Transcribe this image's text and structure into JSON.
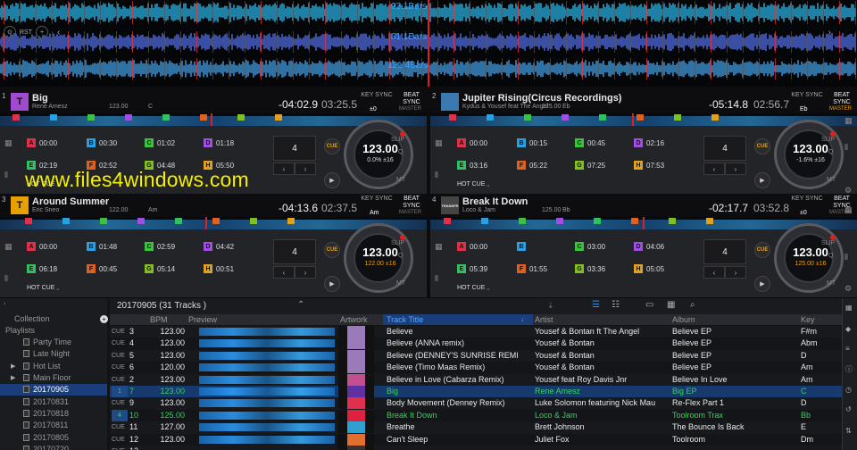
{
  "waveform": {
    "bar_labels": [
      "93.1Bars",
      "81.1Bars",
      "121.4Bars"
    ],
    "left_ctrl": [
      "RST"
    ]
  },
  "decks": [
    {
      "num": "1",
      "title": "Big",
      "artist": "Rene Amesz",
      "bpm": "123.00",
      "key": "C",
      "remain": "-04:02.9",
      "elapsed": "03:25.5",
      "key_label": "KEY SYNC",
      "beat_label": "BEAT SYNC",
      "master": "MASTER",
      "key_val": "±0",
      "art_color": "#a04ad0",
      "art_glyph": "T",
      "beat": "4",
      "jog_bpm": "123.00",
      "jog_pitch": "0.0%  ±16",
      "slip": "SLIP",
      "q": "Q",
      "mt": "MT",
      "mode": "HOT CUE",
      "pads": [
        [
          "A",
          "00:00"
        ],
        [
          "B",
          "00:30"
        ],
        [
          "C",
          "01:02"
        ],
        [
          "D",
          "01:18"
        ],
        [
          "E",
          "02:19"
        ],
        [
          "F",
          "02:52"
        ],
        [
          "G",
          "04:48"
        ],
        [
          "H",
          "05:50"
        ]
      ]
    },
    {
      "num": "2",
      "title": "Jupiter Rising(Circus Recordings)",
      "artist": "Kydus & Yousef feat The Angel",
      "bpm": "125.00",
      "key": "Eb",
      "remain": "-05:14.8",
      "elapsed": "02:56.7",
      "key_label": "KEY SYNC",
      "beat_label": "BEAT SYNC",
      "master": "MASTER",
      "key_val": "Eb",
      "art_color": "#3a7ab0",
      "art_glyph": "",
      "beat": "4",
      "jog_bpm": "123.00",
      "jog_pitch": "-1.6%  ±16",
      "slip": "SLIP",
      "q": "Q",
      "mt": "MT",
      "mode": "HOT CUE",
      "pads": [
        [
          "A",
          "00:00"
        ],
        [
          "B",
          "00:15"
        ],
        [
          "C",
          "00:45"
        ],
        [
          "D",
          "02:16"
        ],
        [
          "E",
          "03:16"
        ],
        [
          "F",
          "05:22"
        ],
        [
          "G",
          "07:25"
        ],
        [
          "H",
          "07:53"
        ]
      ]
    },
    {
      "num": "3",
      "title": "Around Summer",
      "artist": "Eric Sneo",
      "bpm": "122.00",
      "key": "Am",
      "remain": "-04:13.6",
      "elapsed": "02:37.5",
      "key_label": "KEY SYNC",
      "beat_label": "BEAT SYNC",
      "master": "MASTER",
      "key_val": "Am",
      "art_color": "#e8a000",
      "art_glyph": "T",
      "beat": "4",
      "jog_bpm": "123.00",
      "jog_pitch": "122.00  ±16",
      "slip": "SLIP",
      "q": "Q",
      "mt": "MT",
      "mode": "HOT CUE",
      "pads": [
        [
          "A",
          "00:00"
        ],
        [
          "B",
          "01:48"
        ],
        [
          "C",
          "02:59"
        ],
        [
          "D",
          "04:42"
        ],
        [
          "E",
          "06:18"
        ],
        [
          "F",
          "00:45"
        ],
        [
          "G",
          "05:14"
        ],
        [
          "H",
          "00:51"
        ]
      ]
    },
    {
      "num": "4",
      "title": "Break It Down",
      "artist": "Loco & Jam",
      "bpm": "125.00",
      "key": "Bb",
      "remain": "-02:17.7",
      "elapsed": "03:52.8",
      "key_label": "KEY SYNC",
      "beat_label": "BEAT SYNC",
      "master": "MASTER",
      "key_val": "±0",
      "art_color": "#444",
      "art_glyph": "TRANSFR",
      "beat": "4",
      "jog_bpm": "123.00",
      "jog_pitch": "125.00  ±16",
      "slip": "SLIP",
      "q": "Q",
      "mt": "MT",
      "mode": "HOT CUE",
      "pads": [
        [
          "A",
          "00:00"
        ],
        [
          "B",
          ""
        ],
        [
          "C",
          "03:00"
        ],
        [
          "D",
          "04:06"
        ],
        [
          "E",
          "05:39"
        ],
        [
          "F",
          "01:55"
        ],
        [
          "G",
          "03:36"
        ],
        [
          "H",
          "05:05"
        ]
      ]
    }
  ],
  "pad_colors": {
    "A": "#e0304a",
    "B": "#2aa0e0",
    "C": "#40c040",
    "D": "#a050e0",
    "E": "#30c060",
    "F": "#e06020",
    "G": "#80c020",
    "H": "#e0a020"
  },
  "watermark": "www.files4windows.com",
  "browser": {
    "playlist_title": "20170905 (31 Tracks )",
    "tree": [
      {
        "label": "Collection",
        "indent": 16,
        "sel": false,
        "icon": false
      },
      {
        "label": "Playlists",
        "indent": 6,
        "sel": false,
        "icon": false,
        "arrow": "▼"
      },
      {
        "label": "Party Time",
        "indent": 26,
        "sel": false,
        "icon": true
      },
      {
        "label": "Late Night",
        "indent": 26,
        "sel": false,
        "icon": true
      },
      {
        "label": "Hot List",
        "indent": 26,
        "sel": false,
        "icon": true,
        "arrow": "▶"
      },
      {
        "label": "Main Floor",
        "indent": 26,
        "sel": false,
        "icon": true,
        "arrow": "▶"
      },
      {
        "label": "20170905",
        "indent": 26,
        "sel": true,
        "icon": true
      },
      {
        "label": "20170831",
        "indent": 26,
        "sel": false,
        "icon": true
      },
      {
        "label": "20170818",
        "indent": 26,
        "sel": false,
        "icon": true
      },
      {
        "label": "20170811",
        "indent": 26,
        "sel": false,
        "icon": true
      },
      {
        "label": "20170805",
        "indent": 26,
        "sel": false,
        "icon": true
      },
      {
        "label": "20170720",
        "indent": 26,
        "sel": false,
        "icon": true
      }
    ],
    "columns": [
      "BPM",
      "Preview",
      "Artwork",
      "Track Title",
      "Artist",
      "Album",
      "Key"
    ],
    "rows": [
      {
        "cue": "CUE",
        "num": "3",
        "bpm": "123.00",
        "title": "Believe",
        "artist": "Yousef & Bontan ft The Angel",
        "album": "Believe EP",
        "key": "F#m",
        "state": "",
        "art": "#9a7ab8"
      },
      {
        "cue": "CUE",
        "num": "4",
        "bpm": "123.00",
        "title": "Believe (ANNA remix)",
        "artist": "Yousef & Bontan",
        "album": "Believe EP",
        "key": "Abm",
        "state": "",
        "art": "#9a7ab8"
      },
      {
        "cue": "CUE",
        "num": "5",
        "bpm": "123.00",
        "title": "Believe (DENNEY'S SUNRISE REMI",
        "artist": "Yousef & Bontan",
        "album": "Believe EP",
        "key": "D",
        "state": "",
        "art": "#9a7ab8"
      },
      {
        "cue": "CUE",
        "num": "6",
        "bpm": "120.00",
        "title": "Believe (Timo Maas Remix)",
        "artist": "Yousef & Bontan",
        "album": "Believe EP",
        "key": "Am",
        "state": "",
        "art": "#9a7ab8"
      },
      {
        "cue": "CUE",
        "num": "2",
        "bpm": "123.00",
        "title": "Believe in Love (Cabarza Remix)",
        "artist": "Yousef feat Roy Davis Jnr",
        "album": "Believe In Love",
        "key": "Am",
        "state": "",
        "art": "#c05090"
      },
      {
        "cue": "1",
        "num": "7",
        "bpm": "123.00",
        "title": "Big",
        "artist": "Rene Amesz",
        "album": "Big EP",
        "key": "C",
        "state": "sel",
        "art": "#6030a0"
      },
      {
        "cue": "CUE",
        "num": "9",
        "bpm": "123.00",
        "title": "Body Movement (Denney Remix)",
        "artist": "Luke Solomon featuring Nick Mau",
        "album": "Re-Flex Part 1",
        "key": "D",
        "state": "",
        "art": "#e03050"
      },
      {
        "cue": "4",
        "num": "10",
        "bpm": "125.00",
        "title": "Break It Down",
        "artist": "Loco & Jam",
        "album": "Toolroom Trax",
        "key": "Bb",
        "state": "loaded",
        "art": "#e02040"
      },
      {
        "cue": "CUE",
        "num": "11",
        "bpm": "127.00",
        "title": "Breathe",
        "artist": "Brett Johnson",
        "album": "The Bounce Is Back",
        "key": "E",
        "state": "",
        "art": "#30a0d0"
      },
      {
        "cue": "CUE",
        "num": "12",
        "bpm": "123.00",
        "title": "Can't Sleep",
        "artist": "Juliet Fox",
        "album": "Toolroom",
        "key": "Dm",
        "state": "",
        "art": "#e07030"
      },
      {
        "cue": "CUE",
        "num": "13",
        "bpm": "",
        "title": "",
        "artist": "",
        "album": "",
        "key": "",
        "state": "",
        "art": "#333"
      }
    ]
  }
}
